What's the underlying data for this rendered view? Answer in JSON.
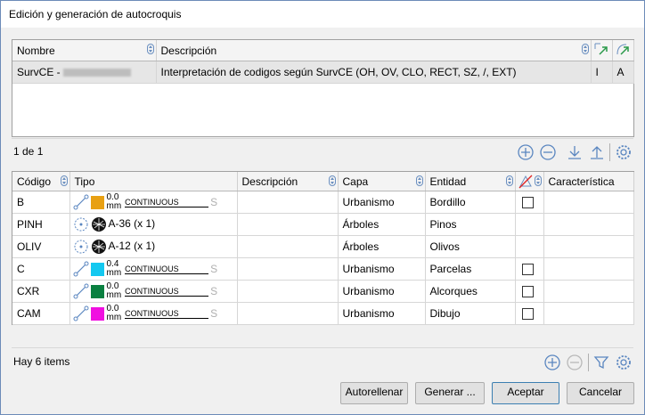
{
  "window": {
    "title": "Edición y generación de autocroquis"
  },
  "top_table": {
    "columns": [
      "Nombre",
      "Descripción"
    ],
    "rows": [
      {
        "name": "SurvCE - ",
        "description": "Interpretación de codigos según SurvCE (OH, OV, CLO, RECT, SZ, /, EXT)",
        "col3": "I",
        "col4": "A"
      }
    ],
    "counter": "1 de 1"
  },
  "codes_table": {
    "columns": [
      "Código",
      "Tipo",
      "Descripción",
      "Capa",
      "Entidad",
      "Característica"
    ],
    "rows": [
      {
        "code": "B",
        "type": "line",
        "color": "#e8a013",
        "width": "0.0",
        "unit": "mm",
        "linetype": "CONTINUOUS",
        "layer": "Urbanismo",
        "entity": "Bordillo",
        "check": true
      },
      {
        "code": "PINH",
        "type": "block",
        "block": "A-36 (x 1)",
        "layer": "Árboles",
        "entity": "Pinos",
        "check": false
      },
      {
        "code": "OLIV",
        "type": "block",
        "block": "A-12 (x 1)",
        "layer": "Árboles",
        "entity": "Olivos",
        "check": false
      },
      {
        "code": "C",
        "type": "line",
        "color": "#14c8f0",
        "width": "0.4",
        "unit": "mm",
        "linetype": "CONTINUOUS",
        "layer": "Urbanismo",
        "entity": "Parcelas",
        "check": true
      },
      {
        "code": "CXR",
        "type": "line",
        "color": "#0a8040",
        "width": "0.0",
        "unit": "mm",
        "linetype": "CONTINUOUS",
        "layer": "Urbanismo",
        "entity": "Alcorques",
        "check": true
      },
      {
        "code": "CAM",
        "type": "line",
        "color": "#f010e0",
        "width": "0.0",
        "unit": "mm",
        "linetype": "CONTINUOUS",
        "layer": "Urbanismo",
        "entity": "Dibujo",
        "check": true
      }
    ]
  },
  "footer": {
    "items_label": "Hay 6 items"
  },
  "buttons": {
    "autofill": "Autorellenar",
    "generate": "Generar ...",
    "accept": "Aceptar",
    "cancel": "Cancelar"
  }
}
